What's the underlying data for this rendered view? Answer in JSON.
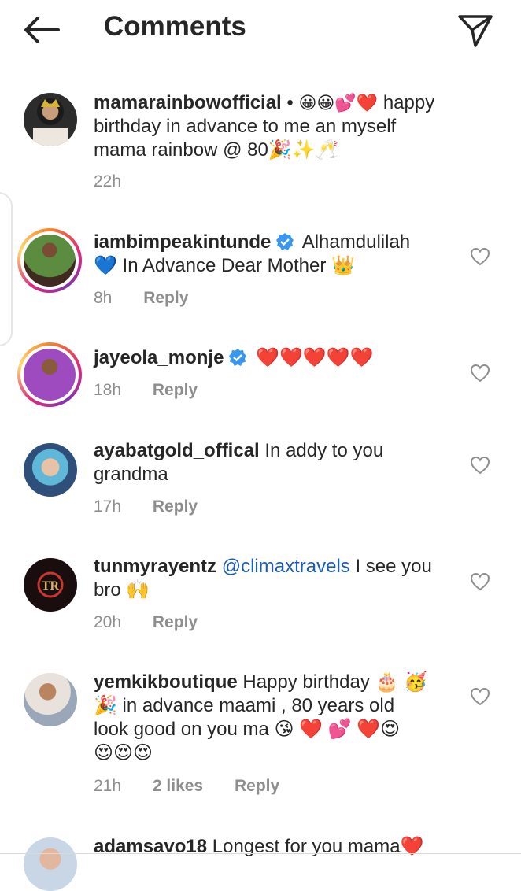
{
  "header": {
    "title": "Comments",
    "back_icon": "arrow-left-icon",
    "share_icon": "paper-plane-icon"
  },
  "comments": [
    {
      "username": "mamarainbowofficial",
      "separator": " •",
      "emojis": "😀😀💕❤️",
      "text_lines": [
        "happy",
        "birthday in advance to me an myself",
        "mama rainbow @ 80🎉✨🥂"
      ],
      "time": "22h"
    },
    {
      "username": "iambimpeakintunde",
      "verified": true,
      "text": "Alhamdulilah",
      "line2": "💙 In Advance Dear Mother 👑",
      "time": "8h",
      "reply": "Reply"
    },
    {
      "username": "jayeola_monje",
      "verified": true,
      "text": "❤️❤️❤️❤️❤️",
      "time": "18h",
      "reply": "Reply"
    },
    {
      "username": "ayabatgold_offical",
      "text": " In addy to you",
      "line2": "grandma",
      "time": "17h",
      "reply": "Reply"
    },
    {
      "username": "tunmyrayentz",
      "mention": "@climaxtravels",
      "text": " I see you",
      "line2": "bro 🙌",
      "time": "20h",
      "reply": "Reply"
    },
    {
      "username": "yemkikboutique",
      "text": " Happy birthday 🎂 🥳",
      "line2": "🎉 in advance maami , 80 years old",
      "line3": "look good on you ma 😘 ❤️ 💕 ❤️😍",
      "line4": "😍😍😍",
      "time": "21h",
      "likes": "2 likes",
      "reply": "Reply"
    },
    {
      "username": "adamsavo18",
      "text": " Longest for you mama❤️"
    }
  ],
  "colors": {
    "link": "#1c5cb4",
    "muted": "#8e8e8e",
    "verified": "#3897f0"
  }
}
